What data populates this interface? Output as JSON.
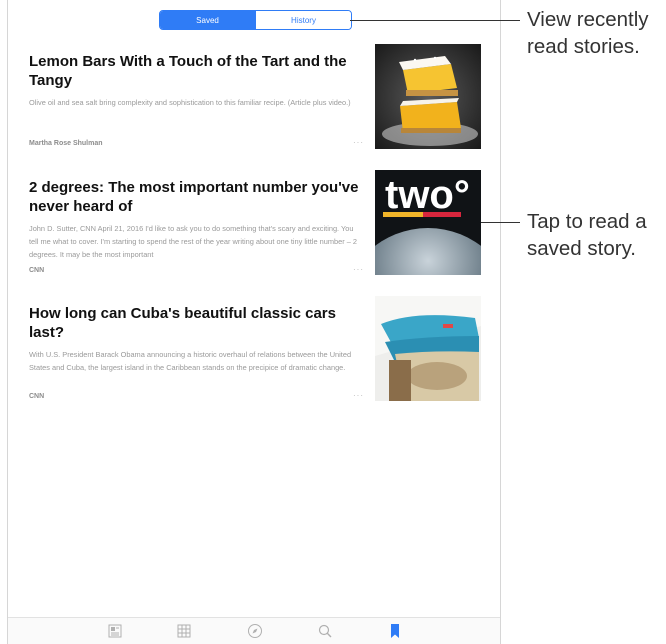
{
  "segmented_control": {
    "saved_label": "Saved",
    "history_label": "History",
    "selected": "Saved"
  },
  "stories": [
    {
      "headline": "Lemon Bars With a Touch of the Tart and the Tangy",
      "excerpt": "Olive oil and sea salt bring complexity and sophistication to this familiar recipe. (Article plus video.)",
      "source": "Martha Rose Shulman"
    },
    {
      "headline": "2 degrees: The most important number you've never heard of",
      "excerpt": "John D. Sutter, CNN April 21, 2016 I'd like to ask you to do something that's scary and exciting. You tell me what to cover. I'm starting to spend the rest of the year writing about one tiny little number – 2 degrees. It may be the most important",
      "source": "CNN",
      "thumb_text": "two°"
    },
    {
      "headline": "How long can Cuba's beautiful classic cars last?",
      "excerpt": "With U.S. President Barack Obama announcing a historic overhaul of relations between the United States and Cuba, the largest island in the Caribbean stands on the precipice of dramatic change.",
      "source": "CNN"
    }
  ],
  "tab_bar": {
    "items": [
      {
        "icon": "for-you-icon"
      },
      {
        "icon": "favorites-grid-icon"
      },
      {
        "icon": "explore-compass-icon"
      },
      {
        "icon": "search-icon"
      },
      {
        "icon": "saved-bookmark-icon",
        "active": true
      }
    ]
  },
  "callouts": {
    "top_line1": "View recently",
    "top_line2": "read stories.",
    "middle_line1": "Tap to read a",
    "middle_line2": "saved story."
  },
  "colors": {
    "accent": "#2f7cf6",
    "headline": "#111111",
    "excerpt": "#9a9a9a"
  }
}
